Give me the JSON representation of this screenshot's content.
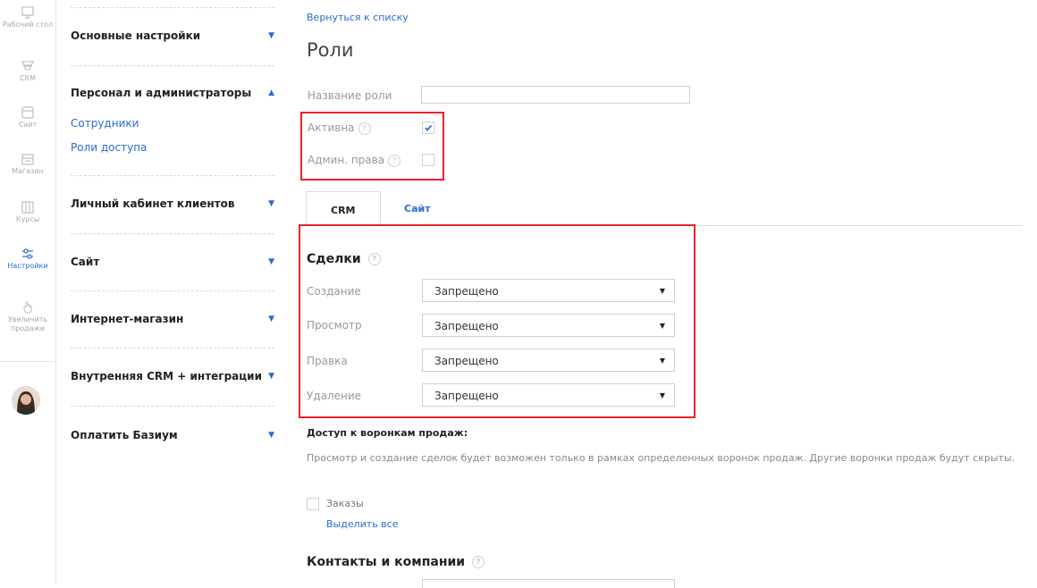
{
  "rail": {
    "items": [
      {
        "label": "Рабочий стол",
        "icon": "desktop-icon"
      },
      {
        "label": "CRM",
        "icon": "funnel-icon"
      },
      {
        "label": "Сайт",
        "icon": "site-icon"
      },
      {
        "label": "Магазин",
        "icon": "shop-icon"
      },
      {
        "label": "Курсы",
        "icon": "courses-icon"
      },
      {
        "label": "Настройки",
        "icon": "settings-sliders-icon",
        "active": true
      },
      {
        "label": "Увеличить продажи",
        "icon": "hand-pointer-icon"
      }
    ]
  },
  "sidebar": {
    "sections": [
      {
        "title": "Основные настройки",
        "expanded": false
      },
      {
        "title": "Персонал и администраторы",
        "expanded": true,
        "links": [
          "Сотрудники",
          "Роли доступа"
        ]
      },
      {
        "title": "Личный кабинет клиентов",
        "expanded": false
      },
      {
        "title": "Сайт",
        "expanded": false
      },
      {
        "title": "Интернет-магазин",
        "expanded": false
      },
      {
        "title": "Внутренняя CRM + интеграции",
        "expanded": false
      },
      {
        "title": "Оплатить Базиум",
        "expanded": false
      }
    ],
    "arrow_down": "▼",
    "arrow_up": "▲"
  },
  "main": {
    "back_link": "Вернуться к списку",
    "title": "Роли",
    "role_name_label": "Название роли",
    "role_name_value": "",
    "active_label": "Активна",
    "active_checked": true,
    "admin_label": "Админ. права",
    "admin_checked": false,
    "help_glyph": "?",
    "tabs": [
      {
        "label": "CRM",
        "active": true
      },
      {
        "label": "Сайт",
        "active": false
      }
    ],
    "deals": {
      "title": "Сделки",
      "rows": [
        {
          "label": "Создание",
          "value": "Запрещено"
        },
        {
          "label": "Просмотр",
          "value": "Запрещено"
        },
        {
          "label": "Правка",
          "value": "Запрещено"
        },
        {
          "label": "Удаление",
          "value": "Запрещено"
        }
      ],
      "caret": "▼"
    },
    "funnels": {
      "title": "Доступ к воронкам продаж:",
      "description": "Просмотр и создание сделок будет возможен только в рамках определенных воронок продаж. Другие воронки продаж будут скрыты.",
      "option": "Заказы",
      "select_all": "Выделить все"
    },
    "contacts_title": "Контакты и компании"
  },
  "colors": {
    "accent": "#2a6bd1",
    "highlight": "#e8232a",
    "muted": "#999999"
  }
}
